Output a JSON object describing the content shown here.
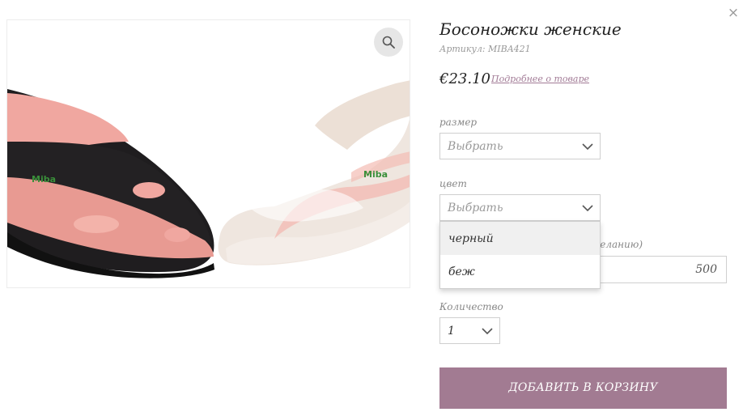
{
  "close_symbol": "×",
  "product": {
    "title": "Босоножки женские",
    "sku": "Артикул: MIBA421",
    "price": "€23.10",
    "details_link": "Подробнее о товаре",
    "brand_insole": "Miba",
    "zoom_icon": "search-icon"
  },
  "size_field": {
    "label": "размер",
    "value": "Выбрать"
  },
  "color_field": {
    "label": "цвет",
    "value": "Выбрать",
    "options": [
      "черный",
      "беж"
    ],
    "hovered_option": "черный"
  },
  "amount_field": {
    "label_partial": "желанию)",
    "value": "500"
  },
  "quantity_field": {
    "label": "Количество",
    "value": "1"
  },
  "add_to_cart_label": "ДОБАВИТЬ В КОРЗИНУ",
  "colors": {
    "accent": "#a27b92",
    "link": "#a27b96"
  }
}
